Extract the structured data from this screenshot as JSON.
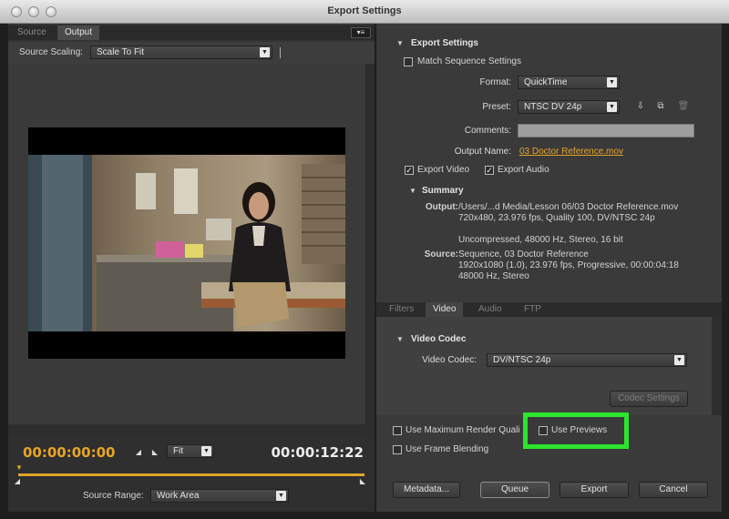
{
  "window": {
    "title": "Export Settings"
  },
  "left_panel": {
    "tabs": [
      "Source",
      "Output"
    ],
    "active_tab": "Output",
    "menu_glyph": "▾≡",
    "source_scaling_label": "Source Scaling:",
    "source_scaling_value": "Scale To Fit",
    "timecode_start": "00:00:00:00",
    "timecode_end": "00:00:12:22",
    "fit_value": "Fit",
    "source_range_label": "Source Range:",
    "source_range_value": "Work Area"
  },
  "export_settings": {
    "heading": "Export Settings",
    "match_sequence_label": "Match Sequence Settings",
    "format_label": "Format:",
    "format_value": "QuickTime",
    "preset_label": "Preset:",
    "preset_value": "NTSC DV 24p",
    "comments_label": "Comments:",
    "output_name_label": "Output Name:",
    "output_name_value": "03 Doctor Reference.mov",
    "export_video_label": "Export Video",
    "export_audio_label": "Export Audio",
    "export_video_checked": true,
    "export_audio_checked": true,
    "check_glyph": "✓"
  },
  "summary": {
    "heading": "Summary",
    "output_key": "Output:",
    "output_lines": [
      "/Users/...d Media/Lesson 06/03 Doctor Reference.mov",
      "720x480, 23.976 fps, Quality 100, DV/NTSC 24p",
      "",
      "Uncompressed, 48000 Hz, Stereo, 16 bit"
    ],
    "source_key": "Source:",
    "source_lines": [
      "Sequence, 03 Doctor Reference",
      "1920x1080 (1.0), 23.976 fps, Progressive, 00:00:04:18",
      "48000 Hz, Stereo"
    ]
  },
  "right_tabs": [
    "Filters",
    "Video",
    "Audio",
    "FTP"
  ],
  "right_active_tab": "Video",
  "video_codec": {
    "heading": "Video Codec",
    "codec_label": "Video Codec:",
    "codec_value": "DV/NTSC 24p",
    "codec_settings_button": "Codec Settings"
  },
  "options": {
    "max_render_label": "Use Maximum Render Quali",
    "use_previews_label": "Use Previews",
    "frame_blending_label": "Use Frame Blending"
  },
  "buttons": {
    "metadata": "Metadata...",
    "queue": "Queue",
    "export": "Export",
    "cancel": "Cancel"
  },
  "colors": {
    "accent": "#e8a526",
    "highlight": "#2ce52c"
  }
}
